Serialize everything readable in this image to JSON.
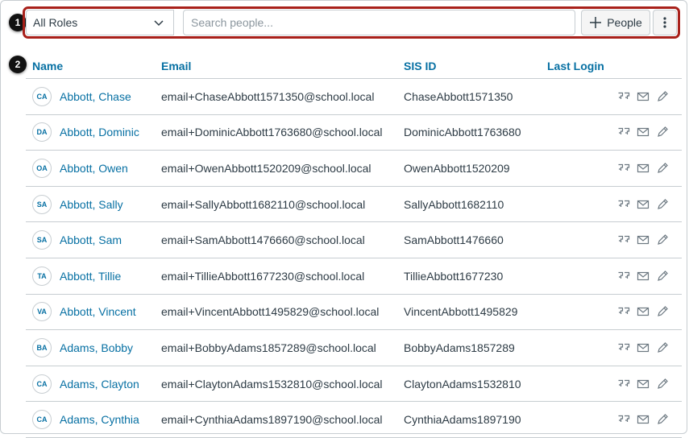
{
  "callouts": [
    "1",
    "2"
  ],
  "toolbar": {
    "role_select_value": "All Roles",
    "search_placeholder": "Search people...",
    "add_people_label": "People"
  },
  "table": {
    "headers": {
      "name": "Name",
      "email": "Email",
      "sis_id": "SIS ID",
      "last_login": "Last Login"
    },
    "rows": [
      {
        "initials": "CA",
        "name": "Abbott, Chase",
        "email": "email+ChaseAbbott1571350@school.local",
        "sis_id": "ChaseAbbott1571350",
        "last_login": ""
      },
      {
        "initials": "DA",
        "name": "Abbott, Dominic",
        "email": "email+DominicAbbott1763680@school.local",
        "sis_id": "DominicAbbott1763680",
        "last_login": ""
      },
      {
        "initials": "OA",
        "name": "Abbott, Owen",
        "email": "email+OwenAbbott1520209@school.local",
        "sis_id": "OwenAbbott1520209",
        "last_login": ""
      },
      {
        "initials": "SA",
        "name": "Abbott, Sally",
        "email": "email+SallyAbbott1682110@school.local",
        "sis_id": "SallyAbbott1682110",
        "last_login": ""
      },
      {
        "initials": "SA",
        "name": "Abbott, Sam",
        "email": "email+SamAbbott1476660@school.local",
        "sis_id": "SamAbbott1476660",
        "last_login": ""
      },
      {
        "initials": "TA",
        "name": "Abbott, Tillie",
        "email": "email+TillieAbbott1677230@school.local",
        "sis_id": "TillieAbbott1677230",
        "last_login": ""
      },
      {
        "initials": "VA",
        "name": "Abbott, Vincent",
        "email": "email+VincentAbbott1495829@school.local",
        "sis_id": "VincentAbbott1495829",
        "last_login": ""
      },
      {
        "initials": "BA",
        "name": "Adams, Bobby",
        "email": "email+BobbyAdams1857289@school.local",
        "sis_id": "BobbyAdams1857289",
        "last_login": ""
      },
      {
        "initials": "CA",
        "name": "Adams, Clayton",
        "email": "email+ClaytonAdams1532810@school.local",
        "sis_id": "ClaytonAdams1532810",
        "last_login": ""
      },
      {
        "initials": "CA",
        "name": "Adams, Cynthia",
        "email": "email+CynthiaAdams1897190@school.local",
        "sis_id": "CynthiaAdams1897190",
        "last_login": ""
      }
    ]
  },
  "icons": {
    "row_actions": [
      "user-group-icon",
      "mail-icon",
      "edit-pencil-icon"
    ],
    "toolbar": [
      "chevron-down-icon",
      "plus-icon",
      "more-vertical-icon"
    ]
  },
  "colors": {
    "link": "#0770a3",
    "highlight": "#a8201a",
    "text": "#2d3b45",
    "border": "#c7cdd1"
  }
}
